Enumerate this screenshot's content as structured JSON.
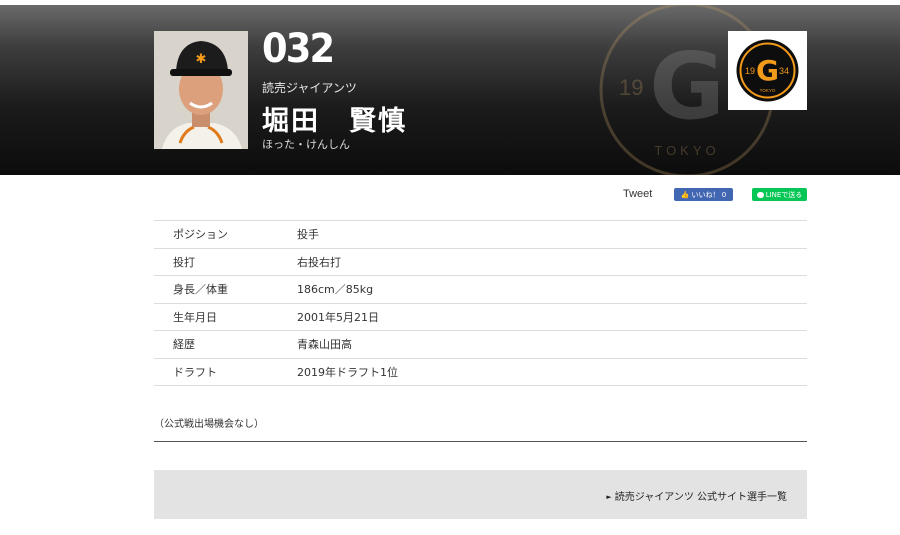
{
  "player": {
    "number": "032",
    "team": "読売ジャイアンツ",
    "name": "堀田　賢慎",
    "kana": "ほった・けんしん"
  },
  "team_logo": {
    "left_digits": "19",
    "letter": "G",
    "right_digits": "34",
    "city": "TOKYO"
  },
  "hero_emblem": {
    "left_digits": "19",
    "letter": "G",
    "city": "TOKYO"
  },
  "social": {
    "tweet": "Tweet",
    "facebook": "いいね！ 0",
    "line": "LINEで送る"
  },
  "profile": [
    {
      "label": "ポジション",
      "value": "投手"
    },
    {
      "label": "投打",
      "value": "右投右打"
    },
    {
      "label": "身長／体重",
      "value": "186cm／85kg"
    },
    {
      "label": "生年月日",
      "value": "2001年5月21日"
    },
    {
      "label": "経歴",
      "value": "青森山田高"
    },
    {
      "label": "ドラフト",
      "value": "2019年ドラフト1位"
    }
  ],
  "note": "（公式戦出場機会なし）",
  "footer": {
    "link": "読売ジャイアンツ 公式サイト選手一覧"
  },
  "colors": {
    "hero_dark": "#111111",
    "accent_orange": "#f29a1a",
    "fb_blue": "#4267b2",
    "line_green": "#06c755"
  }
}
